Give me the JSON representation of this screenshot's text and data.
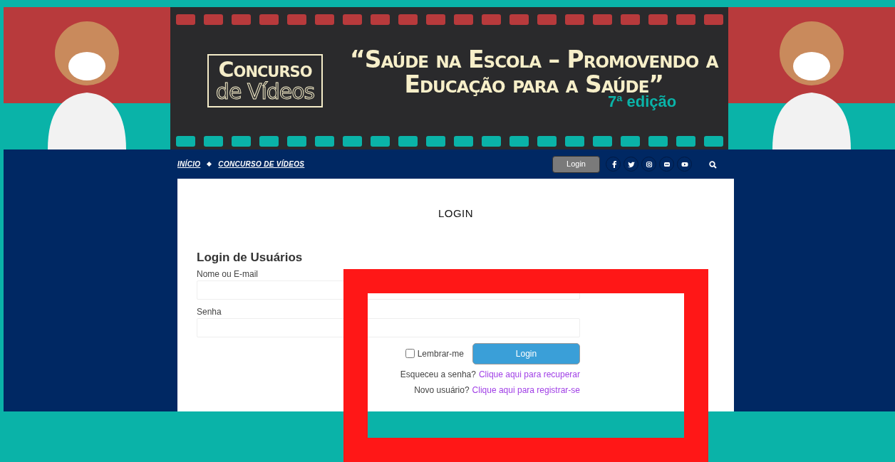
{
  "banner": {
    "badge_line_1": "Concurso",
    "badge_line_2": "de Vídeos",
    "title": "“Saúde na Escola – Promovendo a Educação para a Saúde”",
    "edition": "7ª edição"
  },
  "nav": {
    "breadcrumbs": [
      {
        "label": "INÍCIO"
      },
      {
        "label": "CONCURSO DE VÍDEOS"
      }
    ],
    "login_button": "Login"
  },
  "page": {
    "heading": "LOGIN",
    "form_title": "Login de Usuários",
    "fields": [
      {
        "label": "Nome ou E-mail"
      },
      {
        "label": "Senha"
      }
    ],
    "remember": {
      "label": "Lembrar-me",
      "checked": false
    },
    "submit": "Login",
    "links": [
      {
        "text": "Esqueceu a senha?",
        "link": "Clique aqui para recuperar"
      },
      {
        "text": "Novo usuário?",
        "link": "Clique aqui para registrar-se"
      }
    ]
  }
}
